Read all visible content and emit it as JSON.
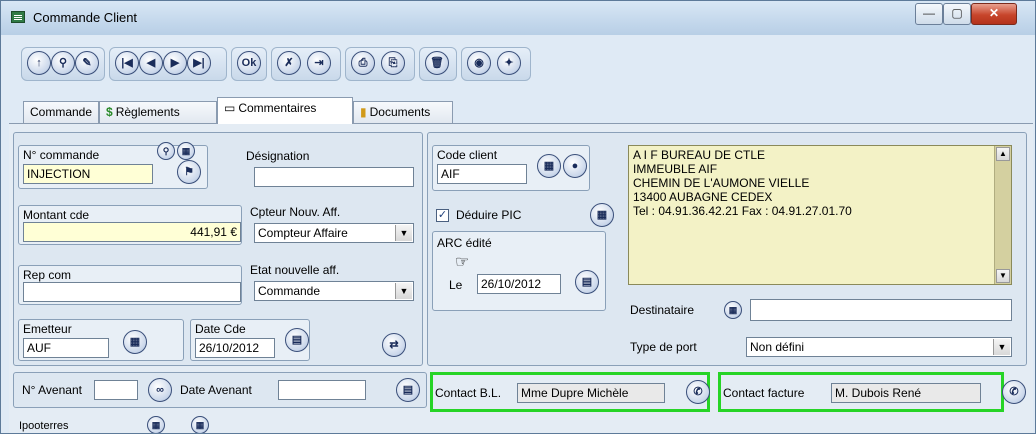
{
  "window": {
    "title": "Commande Client",
    "min_label": "—",
    "max_label": "▢",
    "close_label": "✕"
  },
  "toolbar": {
    "buttons": [
      {
        "name": "new-icon",
        "glyph": "↑"
      },
      {
        "name": "search-record-icon",
        "glyph": "⚲"
      },
      {
        "name": "edit-icon",
        "glyph": "✎"
      },
      {
        "name": "first-icon",
        "glyph": "|◀"
      },
      {
        "name": "prev-icon",
        "glyph": "◀"
      },
      {
        "name": "next-icon",
        "glyph": "▶"
      },
      {
        "name": "last-icon",
        "glyph": "▶|"
      },
      {
        "name": "ok-icon",
        "glyph": "Ok"
      },
      {
        "name": "cancel-icon",
        "glyph": "✗"
      },
      {
        "name": "exit-icon",
        "glyph": "⇥"
      },
      {
        "name": "print-icon",
        "glyph": "⎙"
      },
      {
        "name": "preview-icon",
        "glyph": "⎘"
      },
      {
        "name": "delete-icon",
        "glyph": "🗑"
      },
      {
        "name": "web-icon",
        "glyph": "◉"
      },
      {
        "name": "tools-icon",
        "glyph": "✦"
      }
    ]
  },
  "tabs": [
    {
      "label": "Commande",
      "icon": ""
    },
    {
      "label": "Règlements",
      "icon": "$"
    },
    {
      "label": "Commentaires",
      "icon": "▭"
    },
    {
      "label": "Documents",
      "icon": "▮"
    }
  ],
  "form": {
    "num_commande_label": "N° commande",
    "num_commande_value": "INJECTION",
    "designation_label": "Désignation",
    "designation_value": "",
    "montant_label": "Montant cde",
    "montant_value": "441,91 €",
    "cpteur_label": "Cpteur Nouv. Aff.",
    "cpteur_value": "Compteur Affaire",
    "rep_label": "Rep com",
    "rep_value": "",
    "etat_label": "Etat nouvelle aff.",
    "etat_value": "Commande",
    "emetteur_label": "Emetteur",
    "emetteur_value": "AUF",
    "datecde_label": "Date Cde",
    "datecde_value": "26/10/2012",
    "code_client_label": "Code client",
    "code_client_value": "AIF",
    "deduire_label": "Déduire PIC",
    "deduire_checked": "✓",
    "arc_label": "ARC édité",
    "le_label": "Le",
    "le_value": "26/10/2012",
    "address_lines": [
      "A I F  BUREAU DE CTLE",
      "IMMEUBLE AIF",
      "CHEMIN DE L'AUMONE VIELLE",
      "13400 AUBAGNE CEDEX",
      "Tel : 04.91.36.42.21 Fax : 04.91.27.01.70"
    ],
    "destinataire_label": "Destinataire",
    "destinataire_value": "",
    "type_port_label": "Type de port",
    "type_port_value": "Non défini",
    "avenant_label": "N° Avenant",
    "avenant_value": "",
    "date_avenant_label": "Date Avenant",
    "date_avenant_value": "",
    "contact_bl_label": "Contact B.L.",
    "contact_bl_value": "Mme Dupre  Michèle",
    "contact_fact_label": "Contact facture",
    "contact_fact_value": "M. Dubois  René",
    "bottom_label": "Ipooterres"
  },
  "colors": {
    "highlight": "#26d426",
    "yellow_field": "#ffffd6",
    "address_bg": "#f3f2c6"
  }
}
